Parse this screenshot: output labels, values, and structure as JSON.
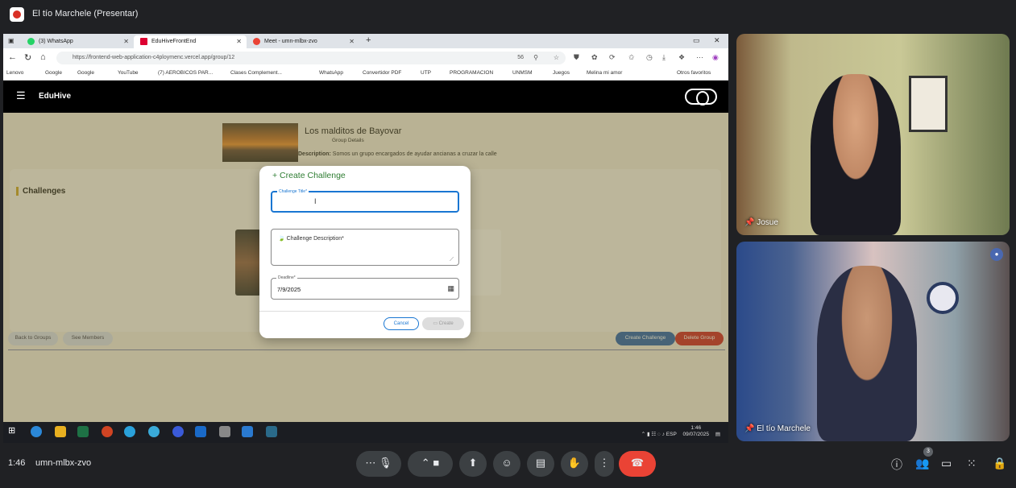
{
  "meet": {
    "presenter_title": "El tío Marchele (Presentar)",
    "time": "1:46",
    "meeting_code": "umn-mlbx-zvo",
    "participants_count": "3",
    "participants": [
      {
        "name": "Josue"
      },
      {
        "name": "El tío Marchele"
      }
    ]
  },
  "browser": {
    "tabs": [
      {
        "label": "(3) WhatsApp"
      },
      {
        "label": "EduHiveFrontEnd"
      },
      {
        "label": "Meet - umn-mlbx-zvo"
      }
    ],
    "url": "https://frontend-web-application-c4ploymenc.vercel.app/group/12",
    "zoom": "56",
    "bookmarks": [
      "Lenovo",
      "Google",
      "Google",
      "YouTube",
      "(7) AEROBICOS PAR...",
      "Clases Complement...",
      "WhatsApp",
      "Convertidor PDF",
      "UTP",
      "PROGRAMACION",
      "UNMSM",
      "Juegos",
      "Melina mi amor",
      "Otros favoritos"
    ]
  },
  "app": {
    "name": "EduHive",
    "group_name": "Los malditos de Bayovar",
    "group_subtitle": "Group Details",
    "description_label": "Description:",
    "description": "Somos un grupo encargados de ayudar ancianas a cruzar la calle",
    "challenges_title": "Challenges",
    "buttons": {
      "back": "Back to Groups",
      "members": "See Members",
      "create_challenge": "Create Challenge",
      "delete_group": "Delete Group"
    }
  },
  "modal": {
    "title": "+ Create Challenge",
    "title_label": "Challenge Title*",
    "title_value": "",
    "description_label": "🍃 Challenge Description*",
    "date_label": "Deadline*",
    "date_value": "7/9/2025",
    "cancel": "Cancel",
    "create": "Create"
  },
  "taskbar": {
    "lang": "ESP",
    "time": "1:46",
    "date": "09/07/2025"
  }
}
